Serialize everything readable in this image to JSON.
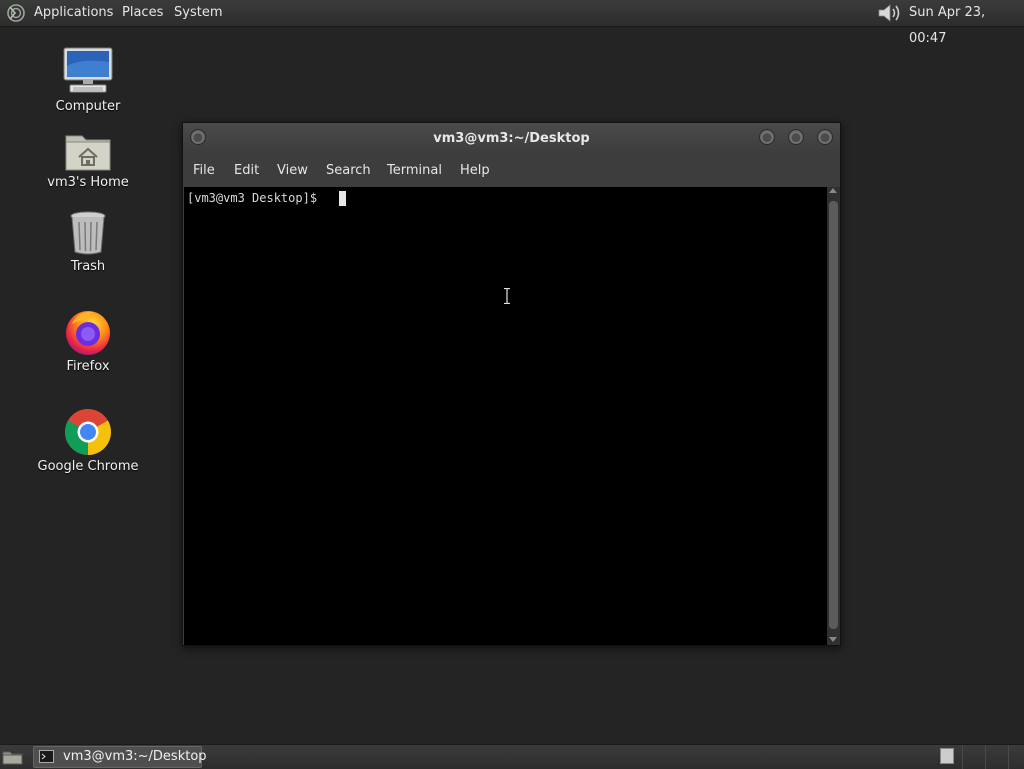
{
  "top_panel": {
    "menus": {
      "applications": "Applications",
      "places": "Places",
      "system": "System"
    },
    "clock": "Sun Apr 23, 00:47",
    "icons": {
      "logo": "gnome-foot-icon",
      "volume": "volume-icon"
    }
  },
  "desktop": {
    "icons": [
      {
        "label": "Computer",
        "icon": "computer-icon"
      },
      {
        "label": "vm3's Home",
        "icon": "home-folder-icon"
      },
      {
        "label": "Trash",
        "icon": "trash-icon"
      },
      {
        "label": "Firefox",
        "icon": "firefox-icon"
      },
      {
        "label": "Google Chrome",
        "icon": "chrome-icon"
      }
    ]
  },
  "terminal": {
    "title": "vm3@vm3:~/Desktop",
    "menus": [
      "File",
      "Edit",
      "View",
      "Search",
      "Terminal",
      "Help"
    ],
    "prompt": "[vm3@vm3 Desktop]$ "
  },
  "taskbar": {
    "items": [
      {
        "label": "vm3@vm3:~/Desktop",
        "icon": "terminal-icon"
      }
    ],
    "workspace_count": 4
  }
}
